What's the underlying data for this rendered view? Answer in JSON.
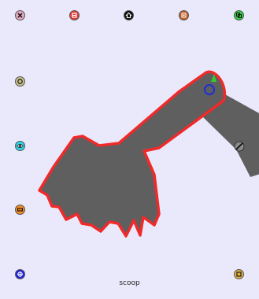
{
  "object_name": "scoop",
  "colors": {
    "background": "#e9e9fb",
    "shape_fill": "#5f5f5f",
    "selection_outline": "#f02a2a",
    "rotation_handle": "#2233cc",
    "pivot_marker": "#33cc33"
  },
  "halo_tools": {
    "top_left": "close-icon",
    "top_center_left": "stop-icon",
    "top_center": "home-icon",
    "top_center_right": "stamp-icon",
    "top_right": "duplicate-icon",
    "left_upper": "rotate-icon",
    "left_middle": "eye-icon",
    "left_lower": "shrink-icon",
    "bottom_left": "collapse-icon",
    "bottom_right": "grow-icon",
    "on_object": "wrench-icon"
  }
}
